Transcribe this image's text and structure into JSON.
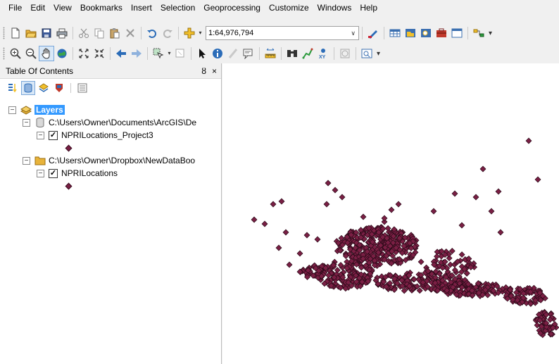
{
  "menu": [
    "File",
    "Edit",
    "View",
    "Bookmarks",
    "Insert",
    "Selection",
    "Geoprocessing",
    "Customize",
    "Windows",
    "Help"
  ],
  "toolbar": {
    "scale": "1:64,976,794",
    "icons_row1": [
      "new-document-icon",
      "open-folder-icon",
      "save-icon",
      "print-icon",
      "cut-icon",
      "copy-icon",
      "paste-icon",
      "delete-icon",
      "undo-icon",
      "redo-icon",
      "add-data-icon",
      "editor-toolbar-icon",
      "table-window-icon",
      "catalog-window-icon",
      "search-window-icon",
      "arctoolbox-icon",
      "python-window-icon",
      "model-builder-icon"
    ],
    "icons_row2": [
      "zoom-in-icon",
      "zoom-out-icon",
      "pan-icon",
      "full-extent-icon",
      "fixed-zoom-in-icon",
      "fixed-zoom-out-icon",
      "back-extent-icon",
      "forward-extent-icon",
      "select-features-icon",
      "clear-selection-icon",
      "select-elements-icon",
      "identify-icon",
      "hyperlink-icon",
      "html-popup-icon",
      "measure-icon",
      "find-icon",
      "find-route-icon",
      "go-to-xy-icon",
      "time-slider-icon",
      "create-viewer-window-icon"
    ]
  },
  "toc": {
    "title": "Table Of Contents",
    "pin": "ȣ",
    "close": "×",
    "tools": [
      "list-by-drawing-order-icon",
      "list-by-source-icon",
      "list-by-visibility-icon",
      "list-by-selection-icon",
      "options-icon"
    ],
    "layers_label": "Layers",
    "groups": [
      {
        "path": "C:\\Users\\Owner\\Documents\\ArcGIS\\De",
        "layer": "NPRILocations_Project3",
        "source_icon": "database-icon"
      },
      {
        "path": "C:\\Users\\Owner\\Dropbox\\NewDataBoo",
        "layer": "NPRILocations",
        "source_icon": "folder-icon"
      }
    ]
  },
  "map": {
    "point_fill": "#7a1f44",
    "point_stroke": "#2a0a18"
  },
  "colors": {
    "selection": "#3399ff",
    "chrome": "#f0f0f0"
  }
}
